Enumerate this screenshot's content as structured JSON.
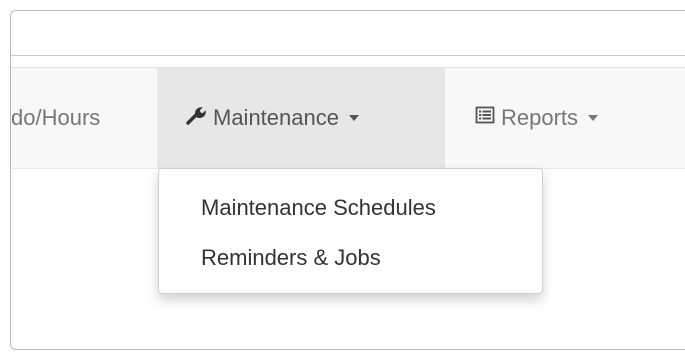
{
  "navbar": {
    "items": [
      {
        "label": "do/Hours"
      },
      {
        "label": "Maintenance",
        "icon": "wrench-icon",
        "active": true
      },
      {
        "label": "Reports",
        "icon": "list-icon"
      }
    ]
  },
  "dropdown": {
    "items": [
      {
        "label": "Maintenance Schedules"
      },
      {
        "label": "Reminders & Jobs"
      }
    ]
  },
  "colors": {
    "navbar_bg": "#f8f8f8",
    "active_item_bg": "#e7e7e7",
    "nav_text": "#777777",
    "dropdown_text": "#333333"
  }
}
